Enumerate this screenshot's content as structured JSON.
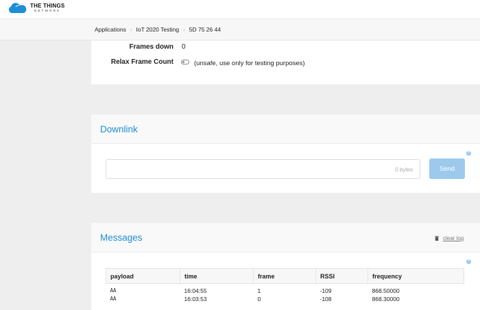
{
  "header": {
    "logo_title": "THE THINGS",
    "logo_subtitle": "NETWORK"
  },
  "breadcrumb": {
    "items": [
      "Applications",
      "IoT 2020 Testing",
      "5D 75 26 44"
    ]
  },
  "counters": {
    "frames_down_label": "Frames down",
    "frames_down_value": "0",
    "relax_label": "Relax Frame Count",
    "relax_hint": "(unsafe, use only for testing purposes)"
  },
  "downlink": {
    "title": "Downlink",
    "payload_value": "",
    "bytes_text": "0 bytes",
    "send_label": "Send",
    "help": "?"
  },
  "messages": {
    "title": "Messages",
    "clear_label": "clear log",
    "help": "?",
    "columns": [
      "payload",
      "time",
      "frame",
      "RSSI",
      "frequency"
    ],
    "rows": [
      [
        "AA",
        "16:04:55",
        "1",
        "-109",
        "868.50000"
      ],
      [
        "AA",
        "16:03:53",
        "0",
        "-108",
        "868.30000"
      ]
    ]
  },
  "colors": {
    "accent": "#1e8ed6",
    "send_button": "#9dcaec",
    "background": "#eeeeee"
  },
  "icons": [
    "cloud-logo-icon",
    "chevron-right-icon",
    "toggle-icon",
    "help-icon",
    "trash-icon"
  ]
}
